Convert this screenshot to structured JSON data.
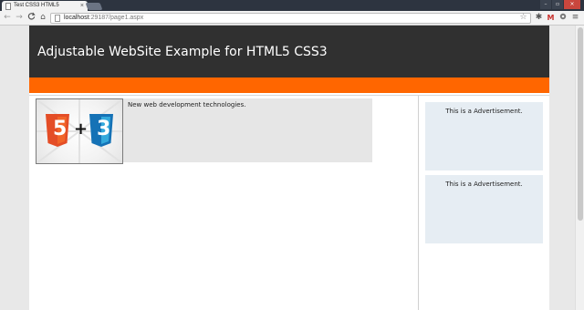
{
  "browser": {
    "tab_title": "Test CSS3 HTML5",
    "tab_close": "×",
    "url_host": "localhost",
    "url_rest": ":29187/page1.aspx",
    "nav": {
      "back": "←",
      "forward": "→",
      "reload": "C",
      "home": "⌂"
    },
    "window_buttons": {
      "minimize": "–",
      "maximize": "▫",
      "close": "×"
    },
    "toolbar_icons": {
      "star": "☆",
      "extension": "✱",
      "mail": "M",
      "settings": "≡"
    }
  },
  "site": {
    "title": "Adjustable WebSite Example for HTML5 CSS3",
    "article_text": "New web development technologies.",
    "image_logos": {
      "html5": "5",
      "plus": "+",
      "css3": "3"
    },
    "ads": [
      "This is a Advertisement.",
      "This is a Advertisement."
    ]
  },
  "colors": {
    "header_bg": "#303030",
    "accent_orange": "#ff6600",
    "html5_orange": "#e44d26",
    "css3_blue": "#2965f1",
    "ad_bg": "#e6edf3",
    "article_bg": "#e6e6e6"
  }
}
